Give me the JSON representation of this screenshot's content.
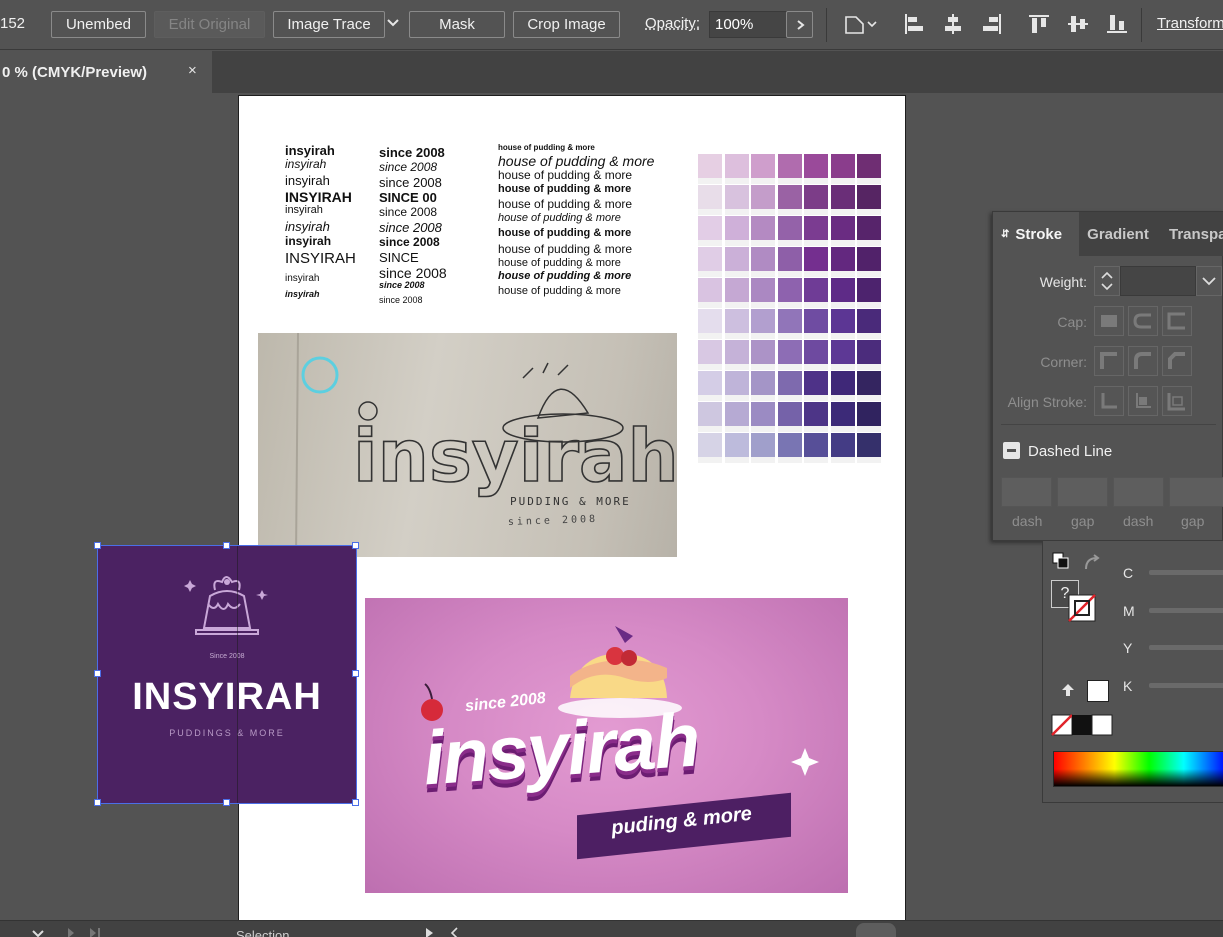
{
  "controlbar": {
    "left_number": "152",
    "unembed": "Unembed",
    "edit_original": "Edit Original",
    "image_trace": "Image Trace",
    "mask": "Mask",
    "crop_image": "Crop Image",
    "opacity_label": "Opacity:",
    "opacity_value": "100%",
    "transform": "Transform"
  },
  "document_tab": {
    "label": "0 % (CMYK/Preview)",
    "close": "×"
  },
  "artboard": {
    "col1": [
      "insyirah",
      "insyirah",
      "insyirah",
      "INSYIRAH",
      "insyirah",
      "insyirah",
      "insyirah",
      "INSYIRAH",
      "insyirah",
      "insyirah"
    ],
    "col2": [
      "since 2008",
      "since 2008",
      "since 2008",
      "SINCE 00",
      "since 2008",
      "since 2008",
      "since 2008",
      "SINCE",
      "since 2008",
      "since 2008",
      "since 2008"
    ],
    "col3": [
      "house of pudding & more",
      "house of pudding & more",
      "house of pudding & more",
      "house of pudding & more",
      "house of pudding & more",
      "house of pudding & more",
      "house of pudding & more",
      "house of pudding & more",
      "house of pudding & more",
      "house of pudding & more",
      "house of pudding & more"
    ],
    "sketch_main": "insyirah",
    "sketch_sub": "PUDDING & MORE",
    "sketch_since": "since 2008"
  },
  "logo_card": {
    "since": "Since 2008",
    "name": "INSYIRAH",
    "tagline": "PUDDINGS & MORE",
    "bg": "#4b2262"
  },
  "pink_logo": {
    "since": "since 2008",
    "main": "insyirah",
    "ribbon": "puding & more"
  },
  "stroke_panel": {
    "tabs": [
      "Stroke",
      "Gradient",
      "Transpa"
    ],
    "weight": "Weight:",
    "cap": "Cap:",
    "corner": "Corner:",
    "align_stroke": "Align Stroke:",
    "dashed_line": "Dashed Line",
    "dash_labels": [
      "dash",
      "gap",
      "dash",
      "gap"
    ]
  },
  "color_panel": {
    "question": "?",
    "channels": [
      "C",
      "M",
      "Y",
      "K"
    ]
  },
  "statusbar": {
    "tool": "Selection"
  },
  "colors": {
    "swatch_rows": [
      [
        "#e6cfe3",
        "#ddbfdd",
        "#cf9ecc",
        "#b06cae",
        "#9a4a9a",
        "#8a3d8c",
        "#6f2e73"
      ],
      [
        "#e8dde9",
        "#d8c2de",
        "#c49dca",
        "#9a62a4",
        "#7c3d88",
        "#6a2e78",
        "#562563"
      ],
      [
        "#e2cde6",
        "#cfb0d9",
        "#b48ac2",
        "#9462a9",
        "#7b3c91",
        "#6a2c82",
        "#57246b"
      ],
      [
        "#e0cde6",
        "#cbb0d8",
        "#b08bc3",
        "#8e5fa8",
        "#742f8f",
        "#63287f",
        "#51226a"
      ],
      [
        "#d9c3e1",
        "#c5a8d3",
        "#ab88c2",
        "#8e62ae",
        "#6f3c96",
        "#5e2b87",
        "#4d236e"
      ],
      [
        "#e4dded",
        "#cdbfdf",
        "#b29fcf",
        "#9175b9",
        "#6f4ca2",
        "#5c3694",
        "#4a2a7a"
      ],
      [
        "#d8c8e3",
        "#c5b2d8",
        "#ac93c7",
        "#8d6db5",
        "#6e4aa0",
        "#5d3895",
        "#4b2c7c"
      ],
      [
        "#d4cde6",
        "#bfb4d9",
        "#a495c7",
        "#7e6aae",
        "#4e3288",
        "#3f2878",
        "#342560"
      ],
      [
        "#cec7e0",
        "#b6aad3",
        "#9b8bc3",
        "#7562a9",
        "#4d3587",
        "#3c2a78",
        "#30235f"
      ],
      [
        "#d6d3e6",
        "#bdbbdc",
        "#a09fcb",
        "#7975b3",
        "#574f98",
        "#443c85",
        "#35306b"
      ]
    ]
  }
}
